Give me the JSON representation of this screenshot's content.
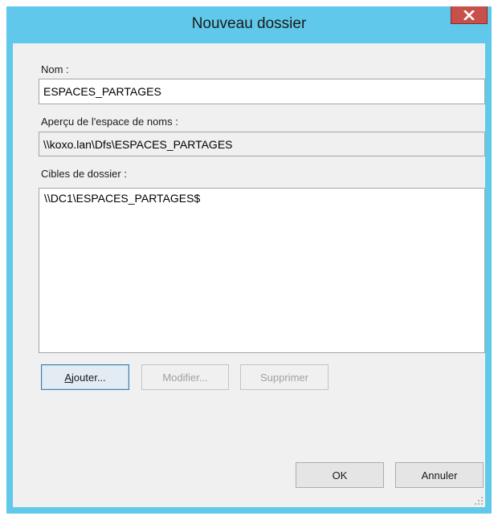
{
  "window": {
    "title": "Nouveau dossier"
  },
  "form": {
    "name_label": "Nom :",
    "name_value": "ESPACES_PARTAGES",
    "preview_label": "Aperçu de l'espace de noms :",
    "preview_value": "\\\\koxo.lan\\Dfs\\ESPACES_PARTAGES",
    "targets_label": "Cibles de dossier :",
    "targets": [
      "\\\\DC1\\ESPACES_PARTAGES$"
    ]
  },
  "buttons": {
    "add_underline": "A",
    "add_rest": "jouter...",
    "modify": "Modifier...",
    "delete": "Supprimer",
    "ok": "OK",
    "cancel": "Annuler"
  },
  "icons": {
    "close": "close-icon",
    "grip": "resize-grip-icon"
  },
  "colors": {
    "frame": "#60c8ea",
    "close_button": "#c7504a",
    "client_bg": "#f0f0f0"
  }
}
